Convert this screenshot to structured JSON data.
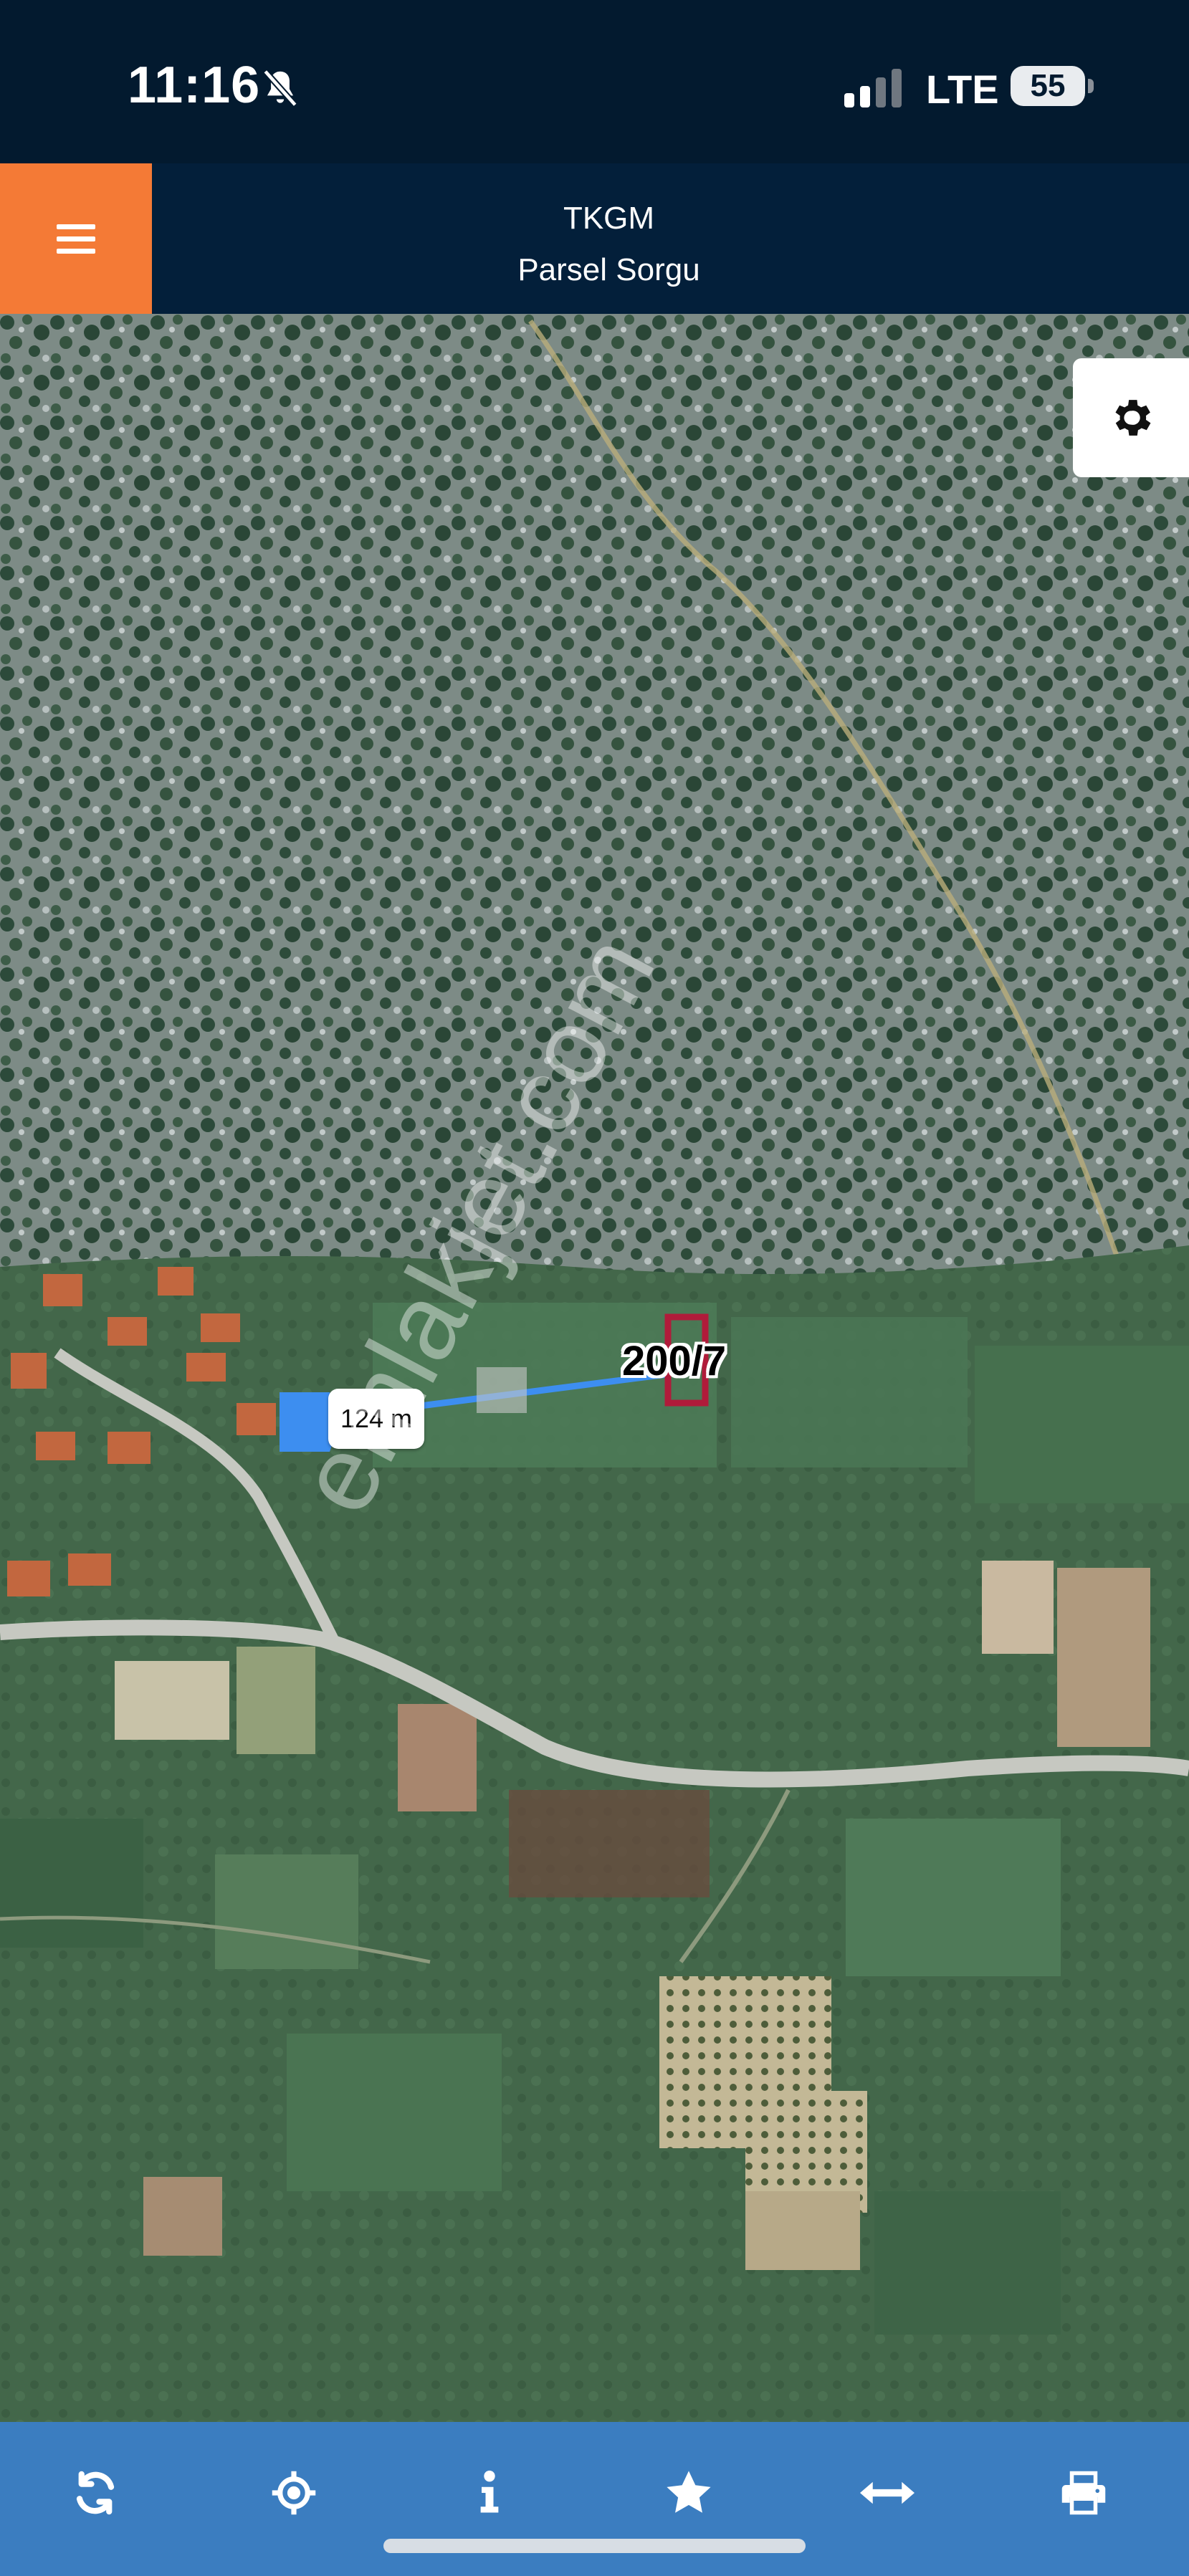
{
  "status_bar": {
    "time": "11:16",
    "network": "LTE",
    "battery": "55",
    "icons": [
      "bell-slash-icon",
      "signal-icon"
    ]
  },
  "header": {
    "title": "TKGM",
    "subtitle": "Parsel Sorgu",
    "menu_icon": "hamburger-menu-icon",
    "accent_color": "#f47a36",
    "background_color": "#031f3a"
  },
  "map": {
    "settings_icon": "gear-icon",
    "distance_label": "124 m",
    "parcel_label": "200/7",
    "watermark": "emlakjet.com",
    "measure_line_color": "#3d8ef0",
    "parcel_outline_color": "#b01b3a"
  },
  "toolbar": {
    "background_color": "#3b7dc0",
    "buttons": [
      {
        "icon": "refresh-icon"
      },
      {
        "icon": "locate-crosshair-icon"
      },
      {
        "icon": "info-icon"
      },
      {
        "icon": "star-icon"
      },
      {
        "icon": "measure-arrows-icon"
      },
      {
        "icon": "print-icon"
      }
    ]
  }
}
